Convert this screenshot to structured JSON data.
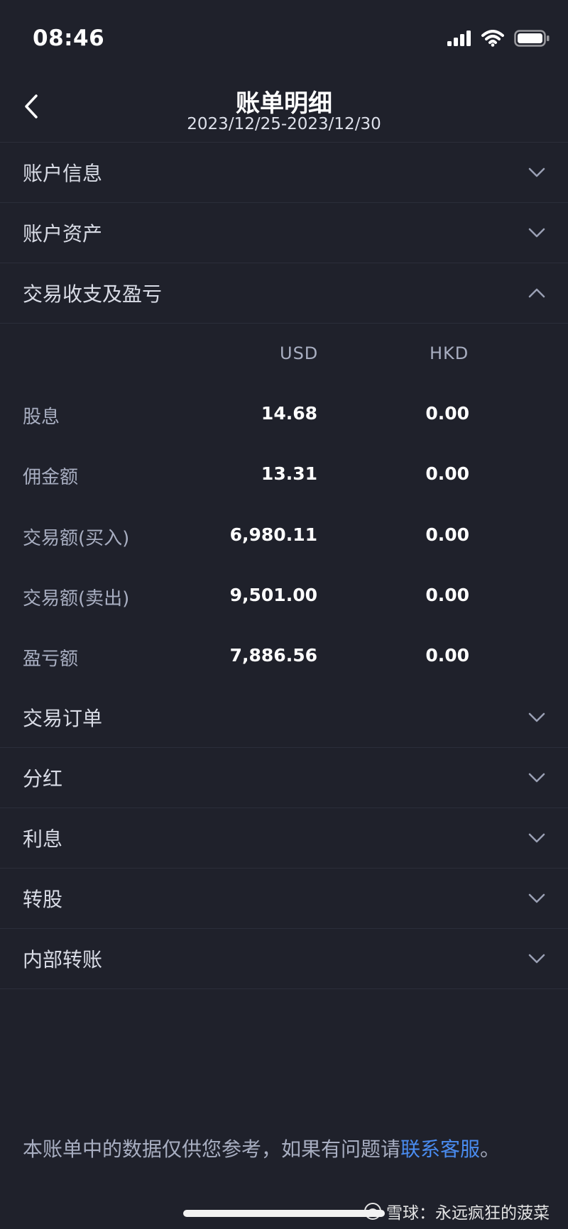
{
  "status_bar": {
    "time": "08:46"
  },
  "header": {
    "title": "账单明细",
    "date_range": "2023/12/25-2023/12/30"
  },
  "sections": {
    "account_info": "账户信息",
    "account_assets": "账户资产",
    "trade_pnl": "交易收支及盈亏",
    "trade_orders": "交易订单",
    "dividends": "分红",
    "interest": "利息",
    "stock_transfer": "转股",
    "internal_transfer": "内部转账"
  },
  "table": {
    "columns": [
      "USD",
      "HKD"
    ],
    "rows": [
      {
        "label": "股息",
        "usd": "14.68",
        "hkd": "0.00"
      },
      {
        "label": "佣金额",
        "usd": "13.31",
        "hkd": "0.00"
      },
      {
        "label": "交易额(买入)",
        "usd": "6,980.11",
        "hkd": "0.00"
      },
      {
        "label": "交易额(卖出)",
        "usd": "9,501.00",
        "hkd": "0.00"
      },
      {
        "label": "盈亏额",
        "usd": "7,886.56",
        "hkd": "0.00"
      }
    ]
  },
  "footer": {
    "note_prefix": "本账单中的数据仅供您参考，如果有问题请",
    "link": "联系客服",
    "note_suffix": "。"
  },
  "watermark": {
    "text": "雪球：永远疯狂的菠菜"
  },
  "icons": {
    "back": "chevron-left-icon",
    "expand": "chevron-down-icon",
    "collapse": "chevron-up-icon",
    "signal": "signal-icon",
    "wifi": "wifi-icon",
    "battery": "battery-icon"
  },
  "colors": {
    "background": "#1f212b",
    "link": "#4a8cf0",
    "label": "#a8aec1"
  }
}
